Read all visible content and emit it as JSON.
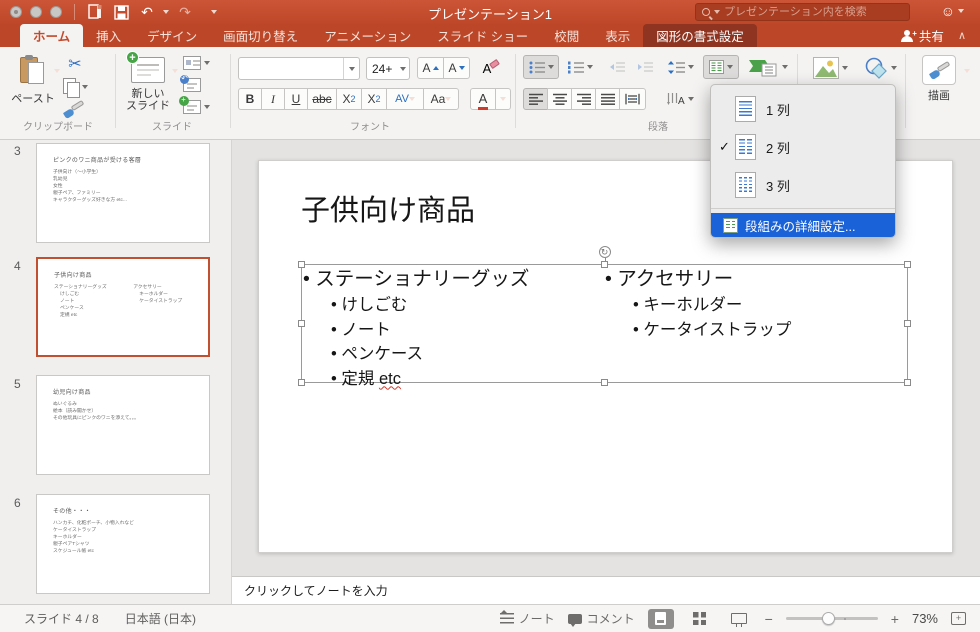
{
  "icons": {
    "check": "✓",
    "undo": "↶",
    "redo": "↷",
    "scissors": "✂",
    "smiley": "☺",
    "rotate": "↻",
    "minus": "−",
    "plus": "+",
    "chevron_up": "∧",
    "person_plus": "+"
  },
  "titlebar": {
    "title": "プレゼンテーション1",
    "search_placeholder": "プレゼンテーション内を検索"
  },
  "tabs": {
    "home": "ホーム",
    "insert": "挿入",
    "design": "デザイン",
    "transitions": "画面切り替え",
    "animations": "アニメーション",
    "slideshow": "スライド ショー",
    "review": "校閲",
    "view": "表示",
    "shape_format": "図形の書式設定",
    "share_label": "共有"
  },
  "ribbon": {
    "clipboard_group_label": "クリップボード",
    "paste_label": "ペースト",
    "slides_group_label": "スライド",
    "new_slide_line1": "新しい",
    "new_slide_line2": "スライド",
    "font_group_label": "フォント",
    "font_size_value": "24+",
    "bold": "B",
    "italic": "I",
    "underline": "U",
    "strikethrough": "abc",
    "superscript": "X",
    "superscript_exp": "2",
    "subscript": "X",
    "subscript_exp": "2",
    "char_spacing": "AV",
    "change_case": "Aa",
    "font_color": "A",
    "grow_font": "A",
    "shrink_font": "A",
    "clear_format": "A",
    "paragraph_group_label": "段落",
    "draw_label": "描画"
  },
  "columns_menu": {
    "one_column": "1 列",
    "two_columns": "2 列",
    "three_columns": "3 列",
    "advanced": "段組みの詳細設定..."
  },
  "thumbnails": [
    {
      "number": "3",
      "title": "ピンクのワニ商品が受ける客層",
      "bullets": [
        "子供向け（〜小学生）",
        "乳幼児",
        "女性",
        "親子ペア、ファミリー",
        "キャラクターグッズ好きな方 etc..."
      ]
    },
    {
      "number": "4",
      "title": "子供向け商品",
      "col1": [
        "ステーショナリーグッズ",
        "けしごむ",
        "ノート",
        "ペンケース",
        "定規 etc"
      ],
      "col2": [
        "アクセサリー",
        "キーホルダー",
        "ケータイストラップ"
      ]
    },
    {
      "number": "5",
      "title": "幼児向け商品",
      "bullets": [
        "ぬいぐるみ",
        "絵本（読み聞かせ）",
        "その他玩具にピンクのワニを添えて。。。"
      ]
    },
    {
      "number": "6",
      "title": "その他・・・",
      "bullets": [
        "ハンカチ、化粧ポーチ、小物入れなど",
        "ケータイストラップ",
        "キーホルダー",
        "親子ペアTシャツ",
        "スケジュール帳 etc"
      ]
    }
  ],
  "slide": {
    "title": "子供向け商品",
    "column1": {
      "heading": "• ステーショナリーグッズ",
      "items": [
        "• けしごむ",
        "• ノート",
        "• ペンケース"
      ],
      "last_text": "• 定規 ",
      "last_flagged": "etc"
    },
    "column2": {
      "heading": "• アクセサリー",
      "items": [
        "• キーホルダー",
        "• ケータイストラップ"
      ]
    }
  },
  "notes": {
    "placeholder": "クリックしてノートを入力"
  },
  "statusbar": {
    "slide_counter": "スライド 4 / 8",
    "language": "日本語 (日本)",
    "notes_label": "ノート",
    "comments_label": "コメント",
    "zoom_level": "73%"
  }
}
